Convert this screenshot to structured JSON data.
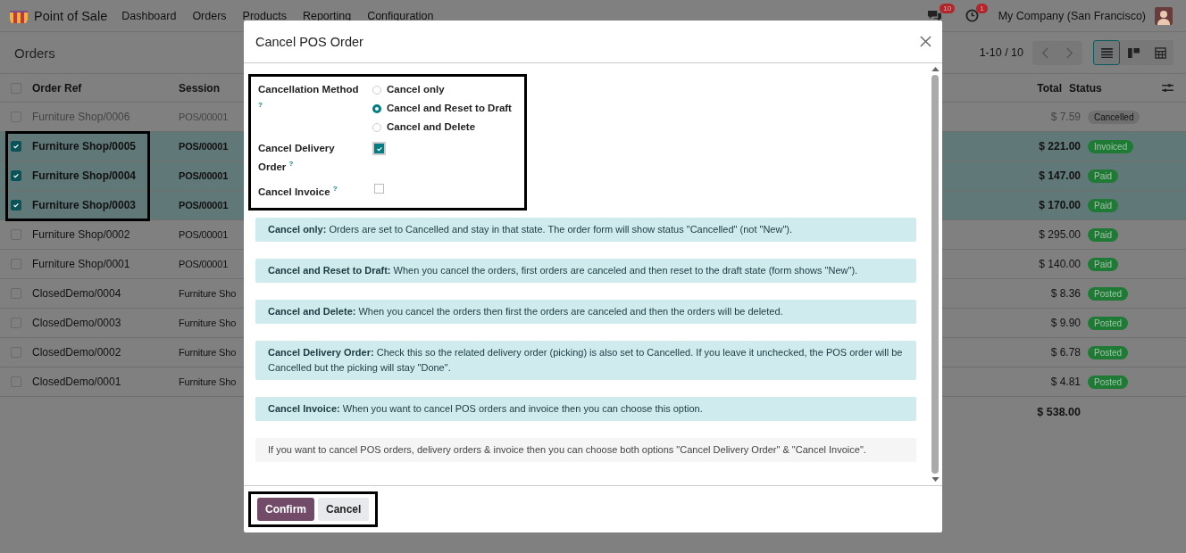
{
  "navbar": {
    "app_name": "Point of Sale",
    "menu": [
      "Dashboard",
      "Orders",
      "Products",
      "Reporting",
      "Configuration"
    ],
    "messages_badge": "10",
    "activities_badge": "1",
    "company": "My Company (San Francisco)"
  },
  "control_panel": {
    "title": "Orders",
    "pager": "1-10 / 10",
    "views": [
      {
        "kind": "list",
        "selected": true
      },
      {
        "kind": "kanban",
        "selected": false
      },
      {
        "kind": "grid",
        "selected": false
      }
    ]
  },
  "table": {
    "select_all_checked": false,
    "columns": [
      "Order Ref",
      "Session",
      "Total",
      "Status"
    ],
    "rows": [
      {
        "order_ref": "Furniture Shop/0006",
        "session": "POS/00001",
        "total": "$ 7.59",
        "status": "Cancelled",
        "color": "#707070",
        "muted": true,
        "selected": false,
        "highlighted": false
      },
      {
        "order_ref": "Furniture Shop/0005",
        "session": "POS/00001",
        "total": "$ 221.00",
        "status": "Invoiced",
        "color": "#1f7a36",
        "muted": false,
        "selected": true,
        "highlighted": true
      },
      {
        "order_ref": "Furniture Shop/0004",
        "session": "POS/00001",
        "total": "$ 147.00",
        "status": "Paid",
        "color": "#1f7a36",
        "muted": false,
        "selected": true,
        "highlighted": true
      },
      {
        "order_ref": "Furniture Shop/0003",
        "session": "POS/00001",
        "total": "$ 170.00",
        "status": "Paid",
        "color": "#1f7a36",
        "muted": false,
        "selected": true,
        "highlighted": true
      },
      {
        "order_ref": "Furniture Shop/0002",
        "session": "POS/00001",
        "total": "$ 295.00",
        "status": "Paid",
        "color": "#1f7a36",
        "muted": false,
        "selected": false,
        "highlighted": false
      },
      {
        "order_ref": "Furniture Shop/0001",
        "session": "POS/00001",
        "total": "$ 140.00",
        "status": "Paid",
        "color": "#1f7a36",
        "muted": false,
        "selected": false,
        "highlighted": false
      },
      {
        "order_ref": "ClosedDemo/0004",
        "session": "Furniture Sho",
        "total": "$ 8.36",
        "status": "Posted",
        "color": "#1f7a36",
        "muted": false,
        "selected": false,
        "highlighted": false
      },
      {
        "order_ref": "ClosedDemo/0003",
        "session": "Furniture Sho",
        "total": "$ 9.90",
        "status": "Posted",
        "color": "#1f7a36",
        "muted": false,
        "selected": false,
        "highlighted": false
      },
      {
        "order_ref": "ClosedDemo/0002",
        "session": "Furniture Sho",
        "total": "$ 6.78",
        "status": "Posted",
        "color": "#1f7a36",
        "muted": false,
        "selected": false,
        "highlighted": false
      },
      {
        "order_ref": "ClosedDemo/0001",
        "session": "Furniture Sho",
        "total": "$ 4.81",
        "status": "Posted",
        "color": "#1f7a36",
        "muted": false,
        "selected": false,
        "highlighted": false
      }
    ],
    "sum": "$ 538.00"
  },
  "dialog": {
    "title": "Cancel POS Order",
    "form_highlighted": true,
    "fields": [
      {
        "kind": "radio",
        "label": "Cancellation Method",
        "help": "?",
        "options": [
          {
            "label": "Cancel only",
            "selected": false
          },
          {
            "label": "Cancel and Reset to Draft",
            "selected": true
          },
          {
            "label": "Cancel and Delete",
            "selected": false
          }
        ]
      },
      {
        "kind": "checkbox",
        "label": "Cancel Delivery Order",
        "help": "?",
        "checked": true
      },
      {
        "kind": "checkbox",
        "label": "Cancel Invoice",
        "help": "?",
        "checked": false
      }
    ],
    "notes": [
      {
        "kind": "info",
        "text": "**Cancel only:** Orders are set to Cancelled and stay in that state. The order form will show status \"Cancelled\" (not \"New\")."
      },
      {
        "kind": "info",
        "text": "**Cancel and Reset to Draft:** When you cancel the orders, first orders are canceled and then reset to the draft state (form shows \"New\")."
      },
      {
        "kind": "info",
        "text": "**Cancel and Delete:** When you cancel the orders then first the orders are canceled and then the orders will be deleted."
      },
      {
        "kind": "info",
        "text": "**Cancel Delivery Order:** Check this so the related delivery order (picking) is also set to Cancelled. If you leave it unchecked, the POS order will be Cancelled but the picking will stay \"Done\"."
      },
      {
        "kind": "info",
        "text": "**Cancel Invoice:** When you want to cancel POS orders and invoice then you can choose this option."
      },
      {
        "kind": "plain",
        "text": "If you want to cancel POS orders, delivery orders & invoice then you can choose both options \"Cancel Delivery Order\" & \"Cancel Invoice\"."
      }
    ],
    "buttons": [
      {
        "label": "Confirm",
        "kind": "primary"
      },
      {
        "label": "Cancel",
        "kind": "secondary"
      }
    ],
    "buttons_highlighted": true
  }
}
